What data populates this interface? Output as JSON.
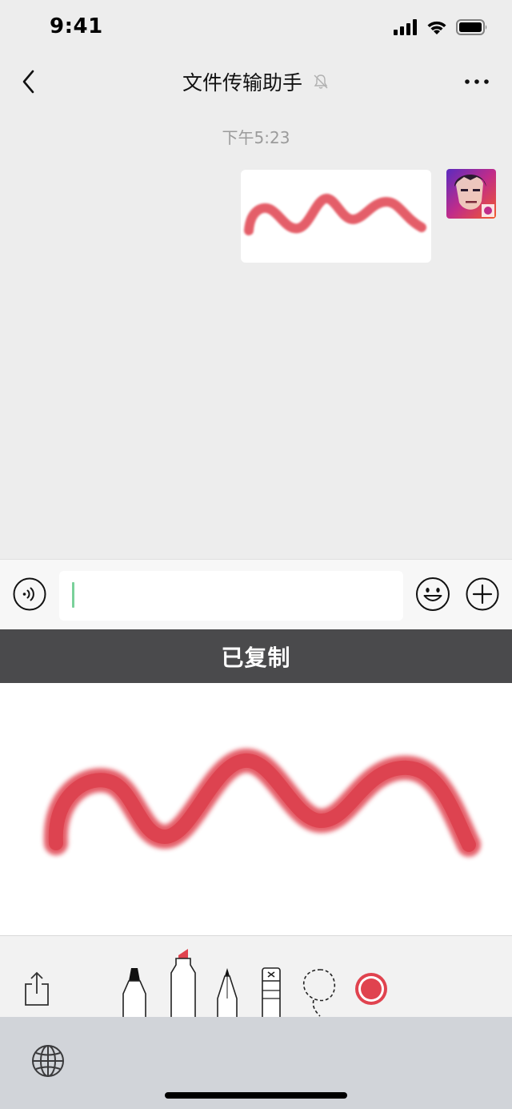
{
  "status_bar": {
    "time": "9:41",
    "icons": [
      "cellular-signal-icon",
      "wifi-icon",
      "battery-icon"
    ]
  },
  "nav": {
    "title": "文件传输助手",
    "back_icon": "chevron-left-icon",
    "mute_icon": "bell-slash-icon",
    "more_icon": "ellipsis-icon"
  },
  "chat": {
    "timestamp": "下午5:23",
    "message_type": "image-sticker"
  },
  "input_bar": {
    "voice_icon": "voice-icon",
    "input_value": "",
    "emoji_icon": "smiley-icon",
    "plus_icon": "plus-circle-icon"
  },
  "banner": {
    "text": "已复制"
  },
  "tools": [
    "share-icon",
    "marker-icon",
    "highlighter-icon",
    "pencil-icon",
    "eraser-icon",
    "lasso-icon",
    "color-picker-icon"
  ],
  "keyboard": {
    "globe_icon": "globe-icon"
  },
  "colors": {
    "ink": "#e0434f",
    "chat_bg": "#ededed",
    "banner_bg": "#4a4a4c",
    "caret": "#7ad19a",
    "keyboard_bg": "#d1d4d9"
  }
}
